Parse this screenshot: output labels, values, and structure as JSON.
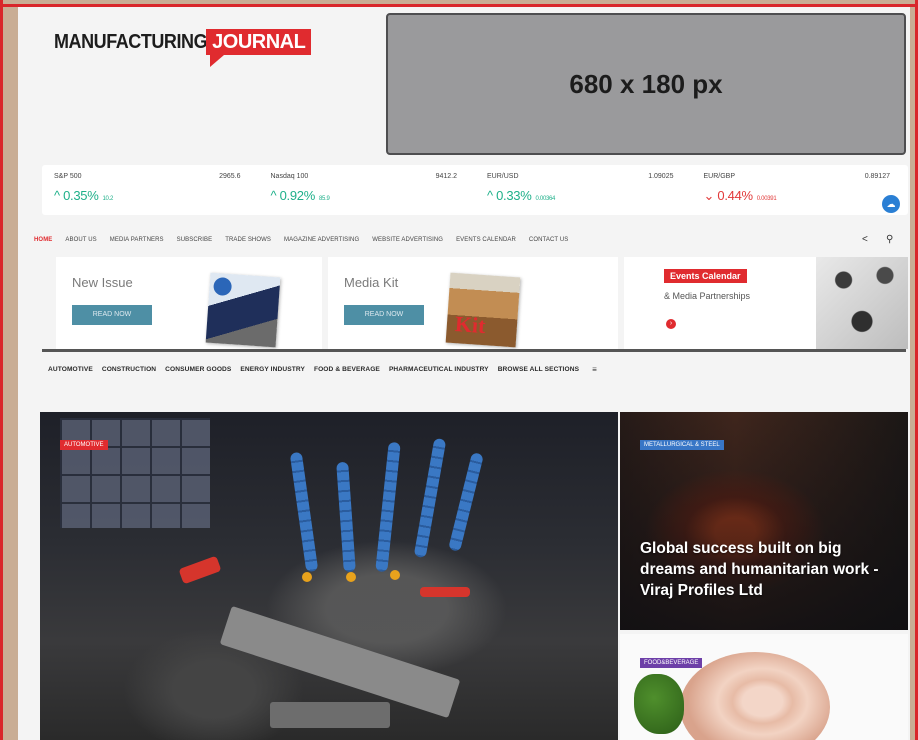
{
  "brand": {
    "name_part1": "MANUFACTURING",
    "name_part2": "JOURNAL",
    "accent": "#e02b2f"
  },
  "ad": {
    "label": "680 x 180 px"
  },
  "ticker": [
    {
      "name": "S&P 500",
      "value": "2965.6",
      "change": "0.35%",
      "delta": "10.2",
      "direction": "up"
    },
    {
      "name": "Nasdaq 100",
      "value": "9412.2",
      "change": "0.92%",
      "delta": "85.9",
      "direction": "up"
    },
    {
      "name": "EUR/USD",
      "value": "1.09025",
      "change": "0.33%",
      "delta": "0.00364",
      "direction": "up"
    },
    {
      "name": "EUR/GBP",
      "value": "0.89127",
      "change": "0.44%",
      "delta": "0.00391",
      "direction": "down"
    }
  ],
  "topnav": {
    "items": [
      "HOME",
      "ABOUT US",
      "MEDIA PARTNERS",
      "SUBSCRIBE",
      "TRADE SHOWS",
      "MAGAZINE ADVERTISING",
      "WEBSITE ADVERTISING",
      "EVENTS CALENDAR",
      "CONTACT US"
    ],
    "share_icon": "share-icon",
    "search_icon": "search-icon"
  },
  "promo": {
    "new_issue": {
      "title": "New Issue",
      "button": "READ NOW"
    },
    "media_kit": {
      "title": "Media Kit",
      "button": "READ NOW",
      "cover_text": "Kit"
    },
    "events": {
      "title": "Events Calendar",
      "subtitle": "& Media Partnerships"
    }
  },
  "sections": [
    "AUTOMOTIVE",
    "CONSTRUCTION",
    "CONSUMER GOODS",
    "ENERGY INDUSTRY",
    "FOOD & BEVERAGE",
    "PHARMACEUTICAL INDUSTRY",
    "BROWSE ALL SECTIONS"
  ],
  "articles": {
    "hero": {
      "category": "AUTOMOTIVE"
    },
    "side1": {
      "category": "METALLURGICAL & STEEL",
      "headline": "Global success built on big dreams and humanitarian work - Viraj Profiles Ltd"
    },
    "side2": {
      "category": "FOOD&BEVERAGE"
    }
  }
}
